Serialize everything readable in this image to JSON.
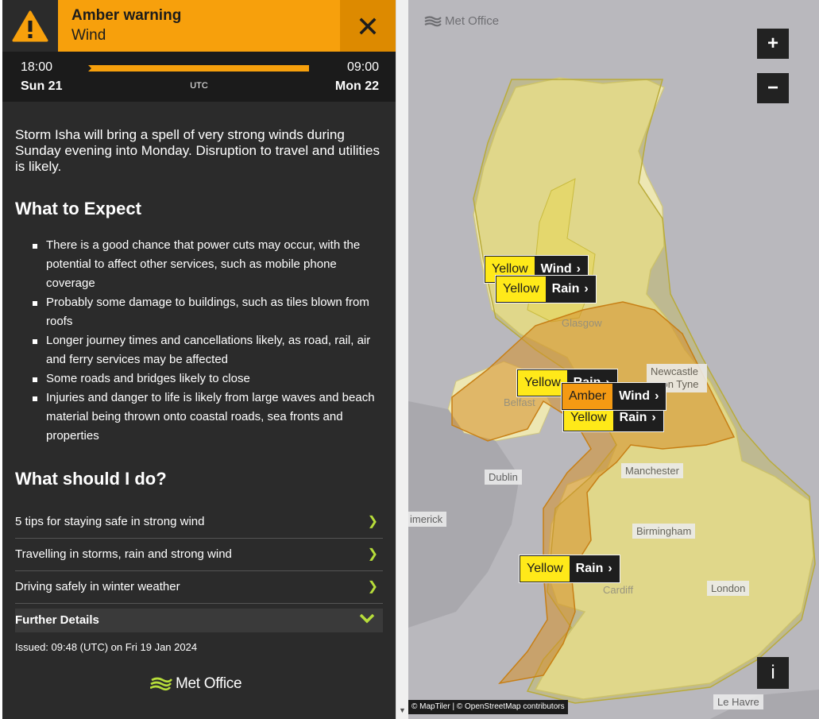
{
  "warning": {
    "level": "Amber warning",
    "type": "Wind",
    "colors": {
      "amber": "#f7a00c",
      "yellow": "#ffe919",
      "accent_green": "#b7dd3a",
      "panel": "#2b2b2b"
    }
  },
  "timeline": {
    "start_time": "18:00",
    "start_day": "Sun 21",
    "end_time": "09:00",
    "end_day": "Mon 22",
    "timezone": "UTC"
  },
  "summary": "Storm Isha will bring a spell of very strong winds during Sunday evening into Monday. Disruption to travel and utilities is likely.",
  "what_to_expect": {
    "heading": "What to Expect",
    "items": [
      "There is a good chance that power cuts may occur, with the potential to affect other services, such as mobile phone coverage",
      "Probably some damage to buildings, such as tiles blown from roofs",
      "Longer journey times and cancellations likely, as road, rail, air and ferry services may be affected",
      "Some roads and bridges likely to close",
      "Injuries and danger to life is likely from large waves and beach material being thrown onto coastal roads, sea fronts and properties"
    ]
  },
  "what_to_do": {
    "heading": "What should I do?",
    "links": [
      "5 tips for staying safe in strong wind",
      "Travelling in storms, rain and strong wind",
      "Driving safely in winter weather"
    ],
    "further_details": "Further Details"
  },
  "issued": "Issued: 09:48 (UTC) on Fri 19 Jan 2024",
  "footer_logo": "Met Office",
  "map": {
    "logo": "Met Office",
    "zoom_in": "+",
    "zoom_out": "−",
    "info": "i",
    "attribution": "© MapTiler | © OpenStreetMap contributors",
    "cities": {
      "glasgow": "Glasgow",
      "newcastle": "Newcastle upon Tyne",
      "belfast": "Belfast",
      "dublin": "Dublin",
      "limerick": "imerick",
      "manchester": "Manchester",
      "birmingham": "Birmingham",
      "cardiff": "Cardiff",
      "london": "London",
      "le_havre": "Le Havre"
    },
    "badges": [
      {
        "level": "Yellow",
        "type": "Wind"
      },
      {
        "level": "Yellow",
        "type": "Rain"
      },
      {
        "level": "Yellow",
        "type": "Rain"
      },
      {
        "level": "Amber",
        "type": "Wind"
      },
      {
        "level": "Yellow",
        "type": "Rain"
      },
      {
        "level": "Yellow",
        "type": "Rain"
      }
    ]
  }
}
